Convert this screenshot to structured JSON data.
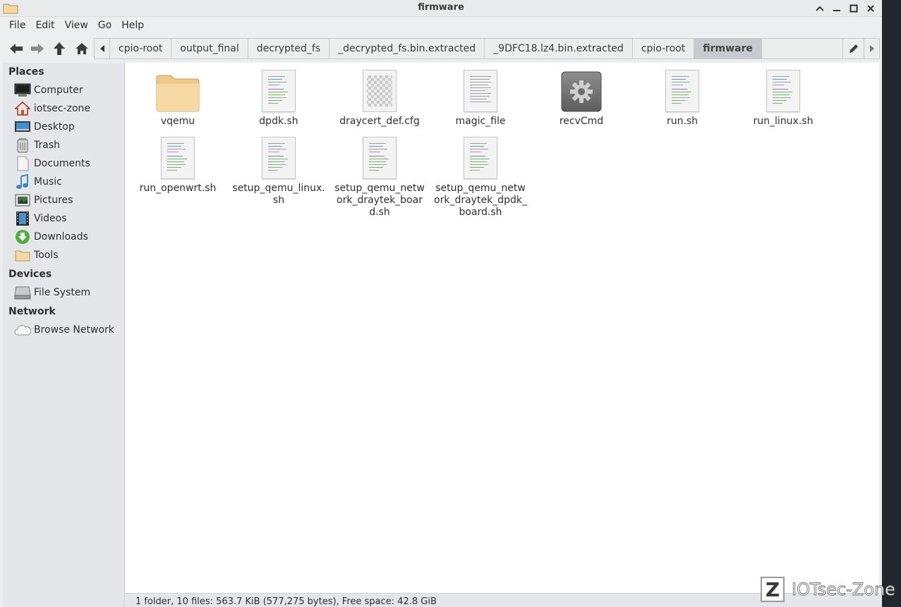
{
  "window": {
    "title": "firmware"
  },
  "menu": [
    "File",
    "Edit",
    "View",
    "Go",
    "Help"
  ],
  "breadcrumbs": [
    "cpio-root",
    "output_final",
    "decrypted_fs",
    "_decrypted_fs.bin.extracted",
    "_9DFC18.lz4.bin.extracted",
    "cpio-root",
    "firmware"
  ],
  "sidebar": {
    "places_heading": "Places",
    "places": [
      {
        "label": "Computer",
        "icon": "computer-icon"
      },
      {
        "label": "iotsec-zone",
        "icon": "home-icon"
      },
      {
        "label": "Desktop",
        "icon": "desktop-icon"
      },
      {
        "label": "Trash",
        "icon": "trash-icon"
      },
      {
        "label": "Documents",
        "icon": "documents-icon"
      },
      {
        "label": "Music",
        "icon": "music-icon"
      },
      {
        "label": "Pictures",
        "icon": "pictures-icon"
      },
      {
        "label": "Videos",
        "icon": "videos-icon"
      },
      {
        "label": "Downloads",
        "icon": "downloads-icon"
      },
      {
        "label": "Tools",
        "icon": "folder-icon"
      }
    ],
    "devices_heading": "Devices",
    "devices": [
      {
        "label": "File System",
        "icon": "drive-icon"
      }
    ],
    "network_heading": "Network",
    "network": [
      {
        "label": "Browse Network",
        "icon": "network-icon"
      }
    ]
  },
  "files": [
    {
      "name": "vqemu",
      "icon": "folder-icon"
    },
    {
      "name": "dpdk.sh",
      "icon": "script-icon"
    },
    {
      "name": "draycert_def.cfg",
      "icon": "config-icon"
    },
    {
      "name": "magic_file",
      "icon": "text-file-icon"
    },
    {
      "name": "recvCmd",
      "icon": "executable-icon"
    },
    {
      "name": "run.sh",
      "icon": "script-icon"
    },
    {
      "name": "run_linux.sh",
      "icon": "script-icon"
    },
    {
      "name": "run_openwrt.sh",
      "icon": "script-icon"
    },
    {
      "name": "setup_qemu_linux.sh",
      "icon": "script-icon"
    },
    {
      "name": "setup_qemu_network_draytek_board.sh",
      "icon": "script-icon"
    },
    {
      "name": "setup_qemu_network_draytek_dpdk_board.sh",
      "icon": "script-icon"
    }
  ],
  "status": "1 folder, 10 files: 563.7 KiB (577,275 bytes), Free space: 42.8 GiB",
  "watermark": {
    "letter": "Z",
    "text": "IOTsec-Zone"
  }
}
